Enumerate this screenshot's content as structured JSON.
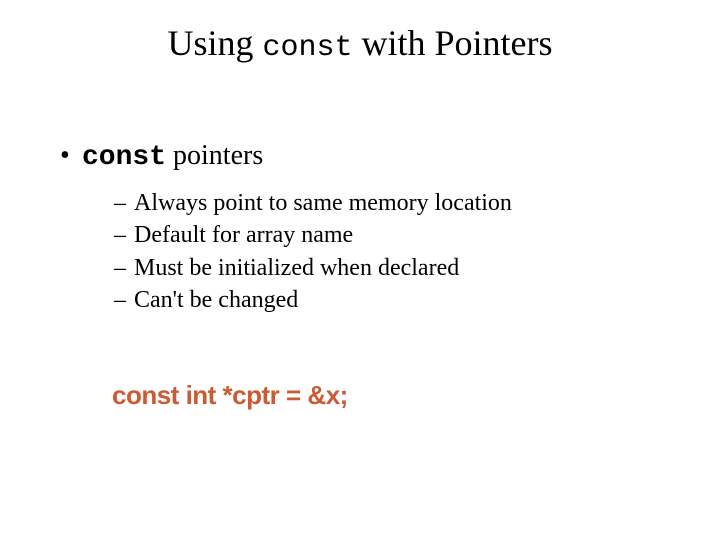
{
  "title": {
    "part1": "Using ",
    "kw": "const",
    "part2": " with Pointers"
  },
  "bullet1": {
    "marker": "•",
    "kw": "const",
    "rest": " pointers"
  },
  "sub": {
    "dash": "–",
    "items": [
      "Always point to same memory location",
      "Default for array name",
      "Must be initialized when declared",
      "Can't be changed"
    ]
  },
  "code": "const int *cptr = &x;"
}
